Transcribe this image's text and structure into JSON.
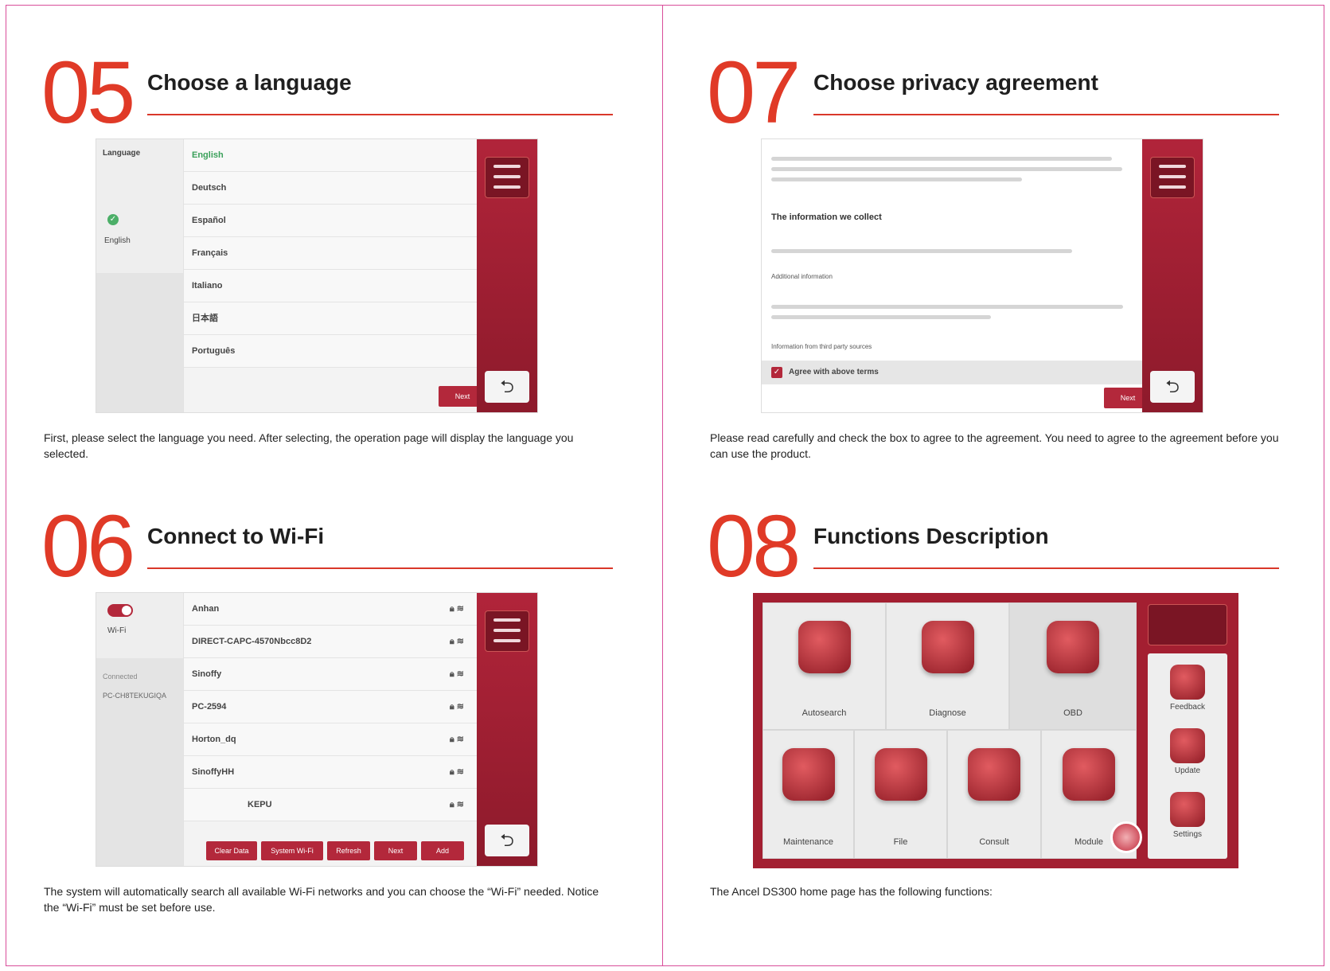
{
  "sections": {
    "s05": {
      "number": "05",
      "title": "Choose a language",
      "description": "First, please select the language you need. After selecting, the operation page will display the language you selected.",
      "screen": {
        "left_header": "Language",
        "left_selected": "English",
        "languages": [
          "English",
          "Deutsch",
          "Español",
          "Français",
          "Italiano",
          "日本語",
          "Português"
        ],
        "selected_language": "English",
        "next_label": "Next"
      }
    },
    "s06": {
      "number": "06",
      "title": "Connect to Wi-Fi",
      "description": "The system will automatically search all available Wi-Fi networks and you can choose the “Wi-Fi” needed. Notice the “Wi-Fi” must be set before use.",
      "screen": {
        "left_label": "Wi-Fi",
        "left_connected": "Connected",
        "left_network": "PC-CH8TEKUGIQA",
        "networks": [
          "Anhan",
          "DIRECT-CAPC-4570Nbcc8D2",
          "Sinoffy",
          "PC-2594",
          "Horton_dq",
          "SinoffyHH",
          "KEPU"
        ],
        "buttons": [
          "Clear Data",
          "System Wi-Fi",
          "Refresh",
          "Next",
          "Add"
        ]
      }
    },
    "s07": {
      "number": "07",
      "title": "Choose privacy agreement",
      "description": "Please read carefully and check the box to agree to the agreement. You need to agree to the agreement before you can use the product.",
      "screen": {
        "heading": "The information we collect",
        "subheading": "Additional information",
        "subheading2": "Information from third party sources",
        "agree_label": "Agree with above terms",
        "next_label": "Next"
      }
    },
    "s08": {
      "number": "08",
      "title": "Functions Description",
      "description": "The Ancel DS300 home page has the following functions:",
      "screen": {
        "tiles_top": [
          "Autosearch",
          "Diagnose",
          "OBD"
        ],
        "tiles_bottom": [
          "Maintenance",
          "File",
          "Consult",
          "Module"
        ],
        "side": [
          "Feedback",
          "Update",
          "Settings"
        ]
      }
    }
  },
  "colors": {
    "accent": "#e03a27",
    "frame": "#d94d9a",
    "device_red": "#b1243a"
  },
  "icons": [
    "back-icon",
    "check-icon",
    "wifi-icon",
    "lock-icon"
  ]
}
